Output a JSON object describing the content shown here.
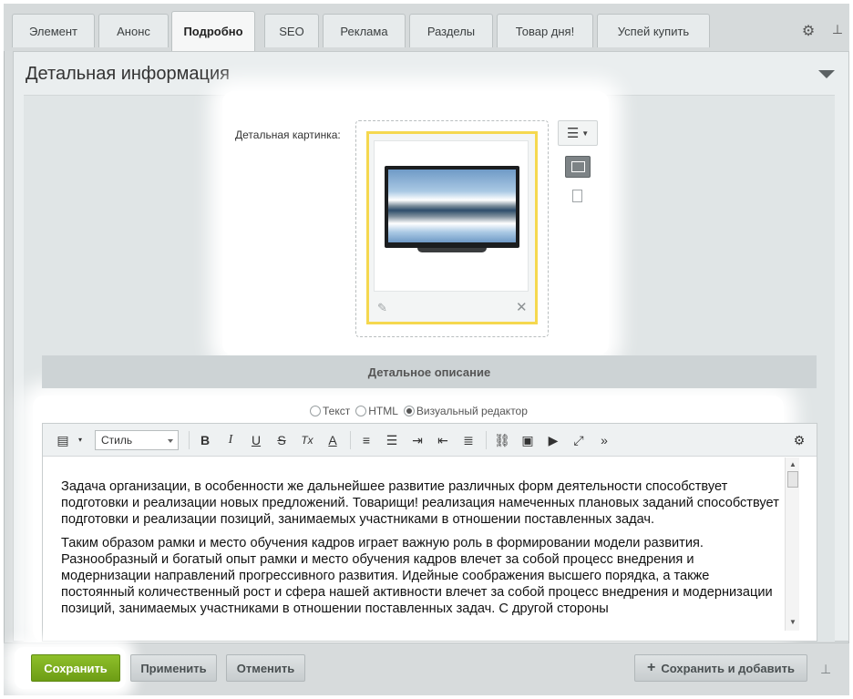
{
  "tabs": [
    {
      "label": "Элемент"
    },
    {
      "label": "Анонс"
    },
    {
      "label": "Подробно"
    },
    {
      "label": "SEO"
    },
    {
      "label": "Реклама"
    },
    {
      "label": "Разделы"
    },
    {
      "label": "Товар дня!"
    },
    {
      "label": "Успей купить"
    }
  ],
  "active_tab": "Подробно",
  "section": {
    "title": "Детальная информация"
  },
  "image_field": {
    "label": "Детальная картинка:"
  },
  "description": {
    "bar_title": "Детальное описание",
    "modes": [
      {
        "label": "Текст",
        "checked": false
      },
      {
        "label": "HTML",
        "checked": false
      },
      {
        "label": "Визуальный редактор",
        "checked": true
      }
    ]
  },
  "editor": {
    "style_select": "Стиль",
    "toolbar": {
      "bold": "B",
      "italic": "I",
      "underline": "U",
      "strike": "S",
      "clear_format": "Tx",
      "font_color": "A",
      "more": "»"
    },
    "paragraphs": [
      "Задача организации, в особенности же дальнейшее развитие различных форм деятельности способствует подготовки и реализации новых предложений. Товарищи! реализация намеченных плановых заданий способствует подготовки и реализации позиций, занимаемых участниками в отношении поставленных задач.",
      "Таким образом рамки и место обучения кадров играет важную роль в формировании модели развития. Разнообразный и богатый опыт рамки и место обучения кадров влечет за собой процесс внедрения и модернизации направлений прогрессивного развития. Идейные соображения высшего порядка, а также постоянный количественный рост и сфера нашей активности влечет за собой процесс внедрения и модернизации позиций, занимаемых участниками в отношении поставленных задач. С другой стороны"
    ]
  },
  "footer": {
    "save": "Сохранить",
    "apply": "Применить",
    "cancel": "Отменить",
    "save_add": "Сохранить и добавить"
  },
  "colors": {
    "save_button": "#7aaa1e",
    "highlight": "#f5d84f"
  }
}
